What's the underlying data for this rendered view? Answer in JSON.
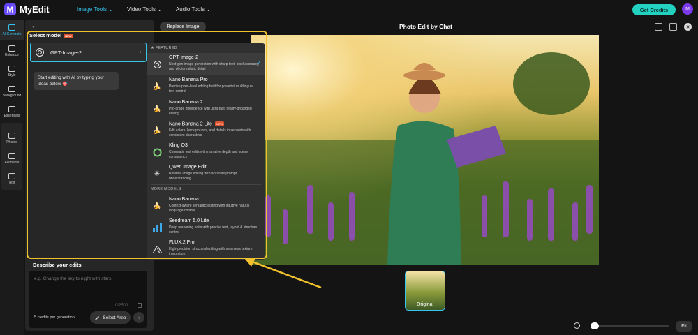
{
  "app": {
    "name": "MyEdit",
    "logo_letter": "M"
  },
  "topnav": {
    "items": [
      {
        "label": "Image Tools ⌄",
        "active": true
      },
      {
        "label": "Video Tools ⌄",
        "active": false
      },
      {
        "label": "Audio Tools ⌄",
        "active": false
      }
    ],
    "credits_button": "Get Credits",
    "avatar_letter": "M"
  },
  "rail": {
    "items": [
      "AI Generate",
      "Enhance",
      "Style",
      "Background",
      "Essentials",
      "Photos",
      "Elements",
      "Text"
    ]
  },
  "panel": {
    "back": "←",
    "select_model_label": "Select model",
    "new_badge": "NEW",
    "selected_model": "GPT-Image-2",
    "caret": "▸",
    "chat_bubble": "Start editing with AI by typing your ideas below 🎯",
    "describe_label": "Describe your edits",
    "describe_placeholder": "e.g. Change the sky to night with stars.",
    "counter": "0/2500",
    "cost_text": "5 credits per generation",
    "select_area_label": "Select Area",
    "send_icon": "↑"
  },
  "dropdown": {
    "featured_label": "★  FEATURED",
    "more_label": "MORE MODELS",
    "check": "✓",
    "featured": [
      {
        "name": "GPT-Image-2",
        "desc": "Next-gen image generation with sharp text, pixel accuracy, and photorealistic detail",
        "icon": "openai-icon",
        "glyph": "✺",
        "selected": true,
        "badge": ""
      },
      {
        "name": "Nano Banana Pro",
        "desc": "Precise pixel-level editing built for powerful multilingual text control",
        "icon": "banana-icon",
        "glyph": "🍌",
        "selected": false,
        "badge": ""
      },
      {
        "name": "Nano Banana 2",
        "desc": "Pro-grade intelligence with ultra-fast, reality-grounded editing",
        "icon": "banana-icon",
        "glyph": "🍌",
        "selected": false,
        "badge": ""
      },
      {
        "name": "Nano Banana 2 Lite",
        "desc": "Edit colors, backgrounds, and details in seconds with consistent characters",
        "icon": "banana-icon",
        "glyph": "🍌",
        "selected": false,
        "badge": "NEW"
      },
      {
        "name": "Kling O3",
        "desc": "Cinematic text edits with narrative depth and scene consistency",
        "icon": "kling-icon",
        "glyph": "◐",
        "selected": false,
        "badge": ""
      },
      {
        "name": "Qwen Image Edit",
        "desc": "Reliable image editing with accurate prompt understanding",
        "icon": "qwen-icon",
        "glyph": "✳",
        "selected": false,
        "badge": ""
      }
    ],
    "more": [
      {
        "name": "Nano Banana",
        "desc": "Context-aware semantic editing with intuitive natural language control",
        "icon": "banana-icon",
        "glyph": "🍌"
      },
      {
        "name": "Seedream 5.0 Lite",
        "desc": "Deep reasoning edits with precise text, layout & structure control",
        "icon": "seedream-icon",
        "glyph": "▮▮▮"
      },
      {
        "name": "FLUX.2 Pro",
        "desc": "High-precision structural editing with seamless texture integration",
        "icon": "flux-icon",
        "glyph": "⟁"
      }
    ]
  },
  "canvas": {
    "replace_button": "Replace Image",
    "title": "Photo Edit by Chat",
    "close_glyph": "✕",
    "thumbnail_label": "Original",
    "zoom_level": 0.05,
    "fit_label": "Fit"
  },
  "colors": {
    "accent": "#35c6f0",
    "credits": "#22d1c0",
    "highlight": "#f2c12e",
    "badge": "#e0532f"
  }
}
